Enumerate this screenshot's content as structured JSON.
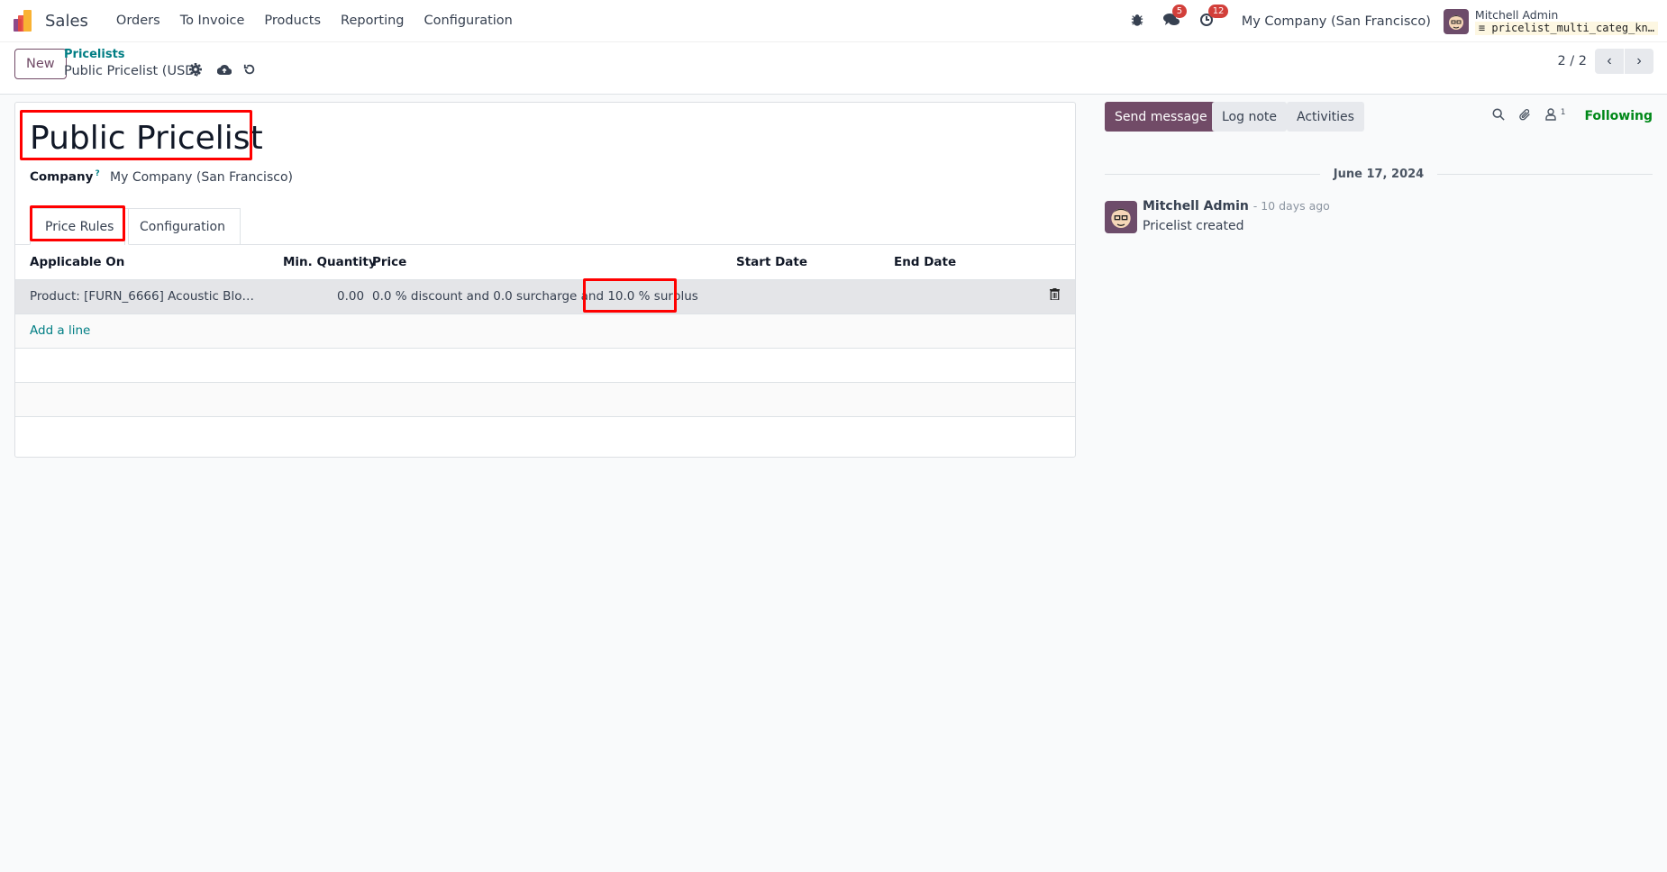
{
  "navbar": {
    "app_name": "Sales",
    "menu": [
      "Orders",
      "To Invoice",
      "Products",
      "Reporting",
      "Configuration"
    ],
    "messages_badge": "5",
    "activities_badge": "12",
    "company": "My Company (San Francisco)",
    "user_name": "Mitchell Admin",
    "database": "pricelist_multi_categ_kn…"
  },
  "control": {
    "new_label": "New",
    "breadcrumb": "Pricelists",
    "record_name": "Public Pricelist (USD)",
    "pager": "2 / 2"
  },
  "form": {
    "title": "Public Pricelist",
    "company_label": "Company",
    "company_help": "?",
    "company_value": "My Company (San Francisco)",
    "tabs": [
      "Price Rules",
      "Configuration"
    ],
    "columns": [
      "Applicable On",
      "Min. Quantity",
      "Price",
      "Start Date",
      "End Date"
    ],
    "rows": [
      {
        "applicable_on": "Product: [FURN_6666] Acoustic Blo…",
        "min_quantity": "0.00",
        "price": "0.0 % discount and 0.0 surcharge and 10.0 % surplus",
        "start_date": "",
        "end_date": ""
      }
    ],
    "add_line": "Add a line"
  },
  "chatter": {
    "send_message": "Send message",
    "log_note": "Log note",
    "activities": "Activities",
    "followers_count": "1",
    "following": "Following",
    "date": "June 17, 2024",
    "message": {
      "author": "Mitchell Admin",
      "time": "- 10 days ago",
      "body": "Pricelist created"
    }
  },
  "colors": {
    "brand": "#714b67",
    "link": "#017e84",
    "following": "#008818",
    "badge": "#d23f3a",
    "highlight": "#ff0000"
  }
}
